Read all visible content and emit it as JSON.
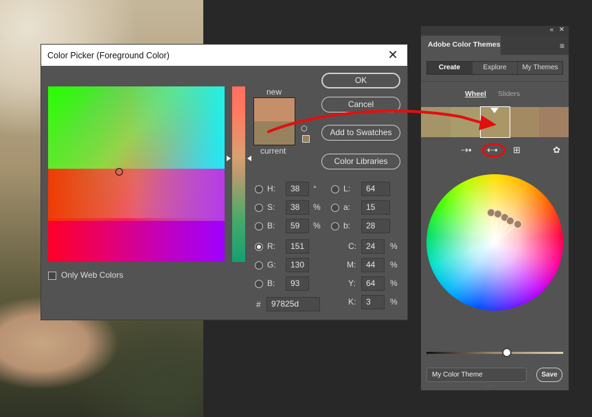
{
  "color_picker": {
    "title": "Color Picker (Foreground Color)",
    "close_glyph": "✕",
    "new_label": "new",
    "current_label": "current",
    "new_color": "#c58f6a",
    "current_color": "#97825d",
    "buttons": {
      "ok": "OK",
      "cancel": "Cancel",
      "add_swatches": "Add to Swatches",
      "color_libraries": "Color Libraries"
    },
    "hsb": [
      {
        "label": "H:",
        "value": "38",
        "unit": "°"
      },
      {
        "label": "S:",
        "value": "38",
        "unit": "%"
      },
      {
        "label": "B:",
        "value": "59",
        "unit": "%"
      }
    ],
    "rgb": [
      {
        "label": "R:",
        "value": "151",
        "selected": true
      },
      {
        "label": "G:",
        "value": "130"
      },
      {
        "label": "B:",
        "value": "93"
      }
    ],
    "lab": [
      {
        "label": "L:",
        "value": "64"
      },
      {
        "label": "a:",
        "value": "15"
      },
      {
        "label": "b:",
        "value": "28"
      }
    ],
    "cmyk": [
      {
        "label": "C:",
        "value": "24",
        "unit": "%"
      },
      {
        "label": "M:",
        "value": "44",
        "unit": "%"
      },
      {
        "label": "Y:",
        "value": "64",
        "unit": "%"
      },
      {
        "label": "K:",
        "value": "3",
        "unit": "%"
      }
    ],
    "hex_label": "#",
    "hex_value": "97825d",
    "only_web_colors": "Only Web Colors",
    "icons": {
      "cube": "cube-icon"
    }
  },
  "color_themes_panel": {
    "top_glyphs": {
      "collapse": "«",
      "close": "✕"
    },
    "tab": "Adobe Color Themes",
    "menu_glyph": "≡",
    "segments": [
      "Create",
      "Explore",
      "My Themes"
    ],
    "active_segment": "Create",
    "sub_tabs": {
      "wheel": "Wheel",
      "sliders": "Sliders"
    },
    "theme_colors": [
      "#a59468",
      "#a99c6c",
      "#a99767",
      "#a38a62",
      "#a07f62"
    ],
    "tool_icons": [
      {
        "name": "set-foreground-from-theme-icon",
        "glyph": "⇢▪"
      },
      {
        "name": "set-theme-from-foreground-icon",
        "glyph": "⇠▪"
      },
      {
        "name": "add-to-swatches-icon",
        "glyph": "⊞"
      },
      {
        "name": "color-rule-icon",
        "glyph": "✿"
      }
    ],
    "theme_name_placeholder": "My Color Theme",
    "save_label": "Save",
    "annotation_color": "#e01010"
  }
}
